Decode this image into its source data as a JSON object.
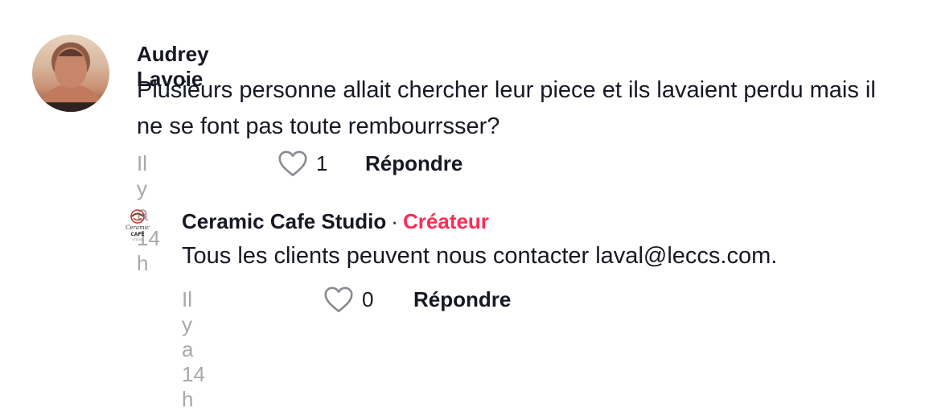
{
  "comment": {
    "author": "Audrey Lavoie",
    "text": "Plusieurs personne allait chercher leur piece et ils lavaient perdu mais il ne se font pas toute rembourrsser?",
    "time": "Il y a 14 h",
    "likes": "1",
    "reply_label": "Répondre"
  },
  "reply": {
    "author": "Ceramic Cafe Studio",
    "separator": "·",
    "badge": "Créateur",
    "text": "Tous les clients peuvent nous contacter laval@leccs.com.",
    "time": "Il y a 14 h",
    "likes": "0",
    "reply_label": "Répondre",
    "logo_text": "Ceramic CAFÉ"
  },
  "colors": {
    "creator_badge": "#fe2c55",
    "muted": "#a7a8ad",
    "text": "#161823"
  },
  "icons": {
    "like": "heart-outline-icon"
  }
}
